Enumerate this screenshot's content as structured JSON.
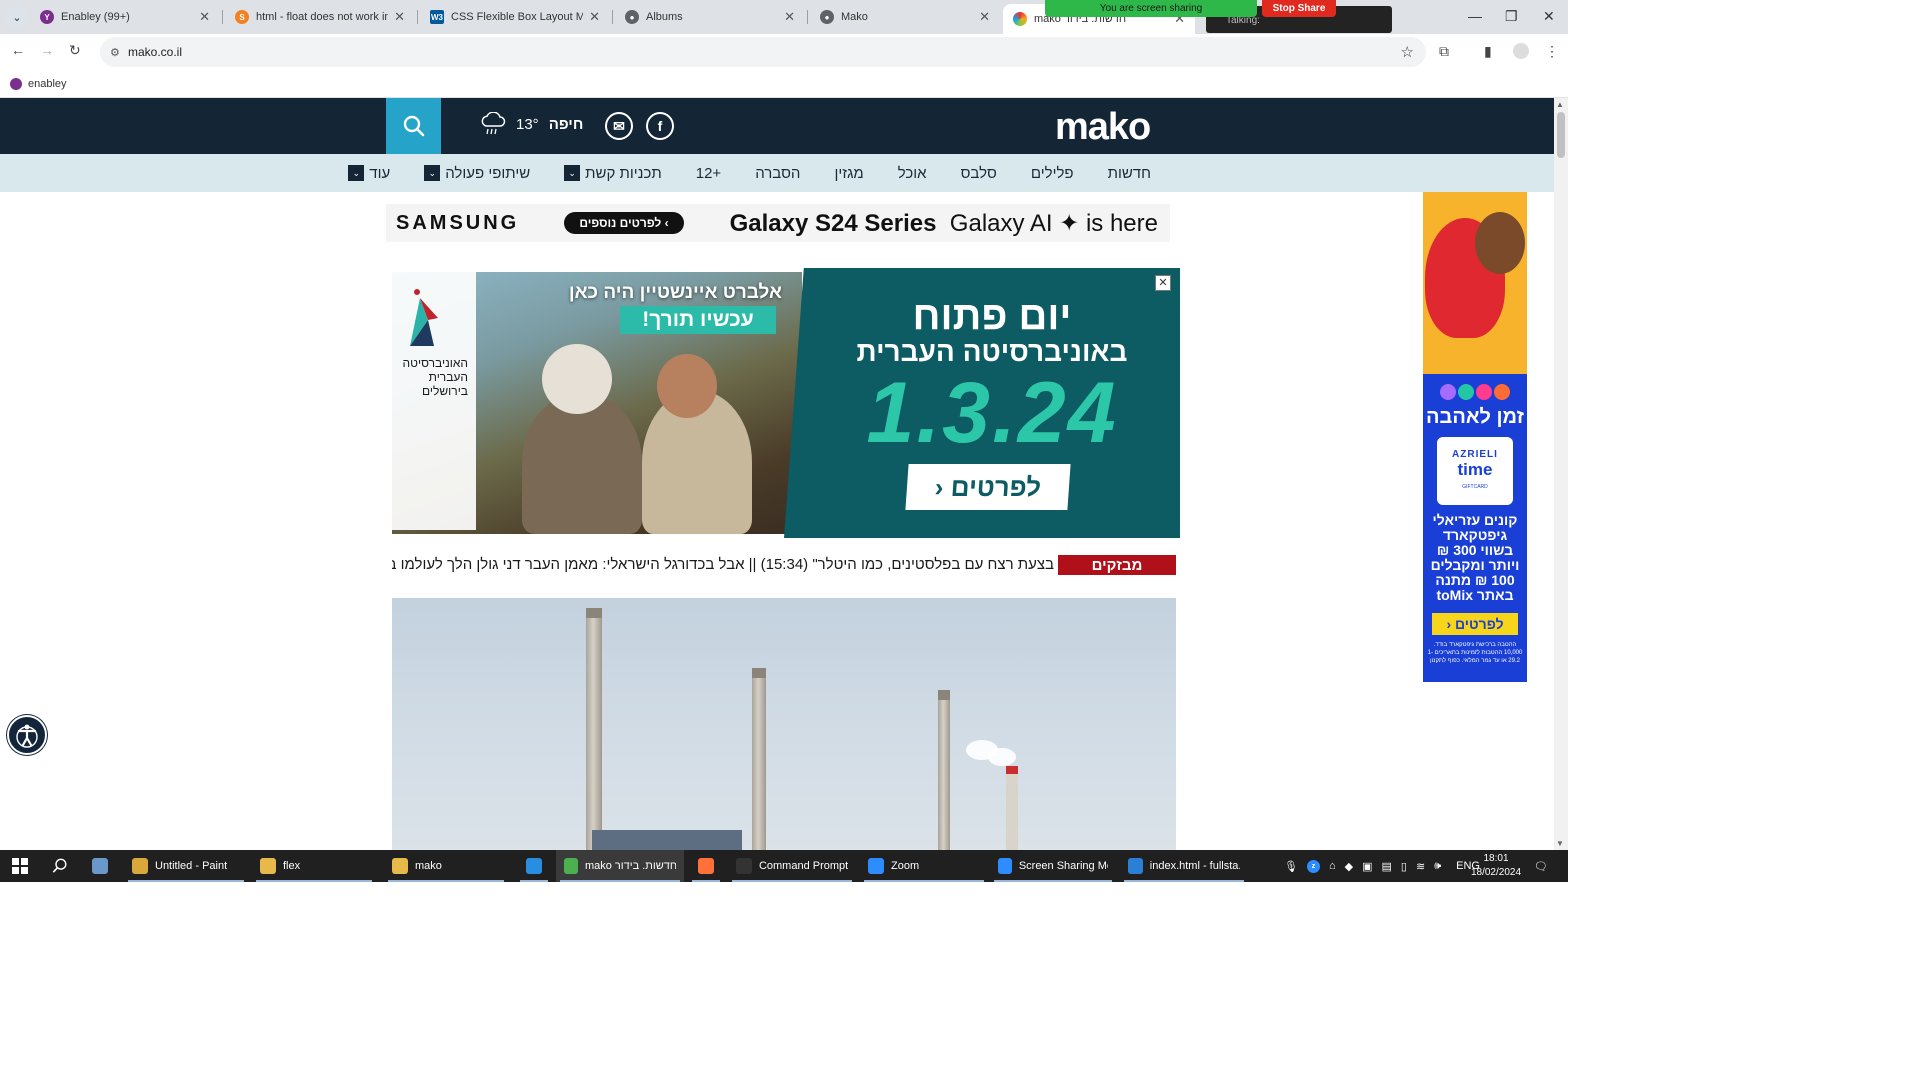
{
  "browser": {
    "tabs": [
      {
        "title": "Enabley (99+)",
        "icon": "enabley-favicon",
        "color": "#7b2e8d",
        "glyph": "Y"
      },
      {
        "title": "html - float does not work in a f",
        "icon": "stackoverflow-favicon",
        "color": "#f48024",
        "glyph": "S"
      },
      {
        "title": "CSS Flexible Box Layout Module",
        "icon": "w3c-favicon",
        "color": "#005a9c",
        "glyph": "W3"
      },
      {
        "title": "Albums",
        "icon": "globe-favicon",
        "color": "#5f6368",
        "glyph": "●"
      },
      {
        "title": "Mako",
        "icon": "globe-favicon",
        "color": "#5f6368",
        "glyph": "●"
      },
      {
        "title": "mako חדשות. בידור",
        "icon": "mako-favicon",
        "color": "#e8312f",
        "glyph": "m"
      }
    ],
    "url": "mako.co.il",
    "bookmark": "enabley",
    "window_controls": {
      "minimize": "—",
      "restore": "❐",
      "close": "✕"
    }
  },
  "zoom_overlay": {
    "sharing_text": "You are screen sharing",
    "stop_label": "Stop Share",
    "talking_label": "Talking:"
  },
  "site": {
    "logo": "mako",
    "weather": {
      "city": "חיפה",
      "temp": "13°"
    },
    "menu": [
      {
        "label": "חדשות",
        "dropdown": false
      },
      {
        "label": "פלילים",
        "dropdown": false
      },
      {
        "label": "סלבס",
        "dropdown": false
      },
      {
        "label": "אוכל",
        "dropdown": false
      },
      {
        "label": "מגזין",
        "dropdown": false
      },
      {
        "label": "הסברה",
        "dropdown": false
      },
      {
        "label": "12+",
        "dropdown": false
      },
      {
        "label": "תכניות קשת",
        "dropdown": true
      },
      {
        "label": "שיתופי פעולה",
        "dropdown": true
      },
      {
        "label": "עוד",
        "dropdown": true
      }
    ],
    "samsung_ad": {
      "brand": "SAMSUNG",
      "button": "לפרטים נוספים",
      "tagline_bold": "Galaxy S24 Series",
      "tagline_rest": "Galaxy AI ✦ is here"
    },
    "huji_ad": {
      "logo_text": "האוניברסיטה העברית בירושלים",
      "headline_1": "אלברט איינשטיין היה כאן",
      "headline_2": "עכשיו תורך!",
      "headline_3": "יום פתוח",
      "headline_4": "באוניברסיטה העברית",
      "date": "1.3.24",
      "cta": "לפרטים",
      "close": "✕"
    },
    "ticker": {
      "label": "מבזקים",
      "text": "בצעת רצח עם בפלסטינים, כמו היטלר\" (15:34) || אבל בכדורגל הישראלי: מאמן העבר דני גולן הלך לעולמו בג"
    },
    "azrieli_ad": {
      "love_title": "זמן לאהבה",
      "brand": "AZRIELI",
      "card": "time",
      "card_sub": "GIFTCARD",
      "body": "קונים עזריאלי גיפטקארד בשווי 300 ₪ ויותר ומקבלים 100 ₪ מתנה באתר toMix",
      "cta": "לפרטים",
      "fine_print": "ההטבה ברכישת גיפטקארד בודד. 10,000 ההטבות לזמינות בתאריכים 1-29.2 או עד גמר המלאי. כפוף לתקנון"
    }
  },
  "taskbar": {
    "apps": [
      {
        "label": "Untitled - Paint",
        "icon": "paint-icon",
        "color": "#d9a83a"
      },
      {
        "label": "flex",
        "icon": "folder-icon",
        "color": "#e7b84a"
      },
      {
        "label": "mako",
        "icon": "folder-icon",
        "color": "#e7b84a"
      },
      {
        "label": "",
        "icon": "edge-icon",
        "color": "#2a8ee0"
      },
      {
        "label": "mako חדשות. בידור....",
        "icon": "chrome-icon",
        "color": "#4caf50"
      },
      {
        "label": "",
        "icon": "firefox-icon",
        "color": "#ff7139"
      },
      {
        "label": "Command Prompt",
        "icon": "cmd-icon",
        "color": "#333333"
      },
      {
        "label": "Zoom",
        "icon": "zoom-icon",
        "color": "#2d8cff"
      },
      {
        "label": "Screen Sharing Me...",
        "icon": "zoom-icon",
        "color": "#2d8cff"
      },
      {
        "label": "index.html - fullsta...",
        "icon": "vscode-icon",
        "color": "#2b7fd4"
      }
    ],
    "language": "ENG",
    "time": "18:01",
    "date": "18/02/2024"
  }
}
